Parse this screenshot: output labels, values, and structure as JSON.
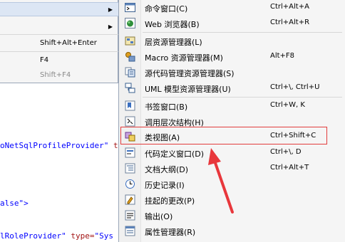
{
  "parent_menu": {
    "items": [
      {
        "label": "",
        "shortcut": "",
        "submenu": true
      },
      {
        "label": "",
        "shortcut": "",
        "submenu": true
      },
      {
        "label": "",
        "shortcut": "Shift+Alt+Enter",
        "submenu": false
      },
      {
        "label": "",
        "shortcut": "F4",
        "submenu": false
      },
      {
        "label": "",
        "shortcut": "Shift+F4",
        "submenu": false,
        "disabled": true
      }
    ]
  },
  "code_lines": [
    {
      "parts": [
        {
          "text": "oNetSqlProfileProvider\"",
          "cls": "c-blue"
        },
        {
          "text": " t",
          "cls": "c-red"
        }
      ]
    },
    {
      "parts": [
        {
          "text": "alse\">",
          "cls": "c-blue"
        }
      ]
    },
    {
      "parts": [
        {
          "text": "lRoleProvider\"",
          "cls": "c-blue"
        },
        {
          "text": " type=",
          "cls": "c-red"
        },
        {
          "text": "\"Sys",
          "cls": "c-blue"
        }
      ]
    }
  ],
  "submenu": {
    "items": [
      {
        "label": "命令窗口(C)",
        "shortcut": "Ctrl+Alt+A",
        "icon": "command-window-icon"
      },
      {
        "label": "Web 浏览器(B)",
        "shortcut": "Ctrl+Alt+R",
        "icon": "web-browser-icon"
      },
      {
        "label": "层资源管理器(L)",
        "shortcut": "",
        "icon": "layer-explorer-icon"
      },
      {
        "label": "Macro 资源管理器(M)",
        "shortcut": "Alt+F8",
        "icon": "macro-explorer-icon"
      },
      {
        "label": "源代码管理资源管理器(S)",
        "shortcut": "",
        "icon": "source-control-icon"
      },
      {
        "label": "UML 模型资源管理器(U)",
        "shortcut": "Ctrl+\\, Ctrl+U",
        "icon": "uml-explorer-icon"
      },
      {
        "label": "书签窗口(B)",
        "shortcut": "Ctrl+W, K",
        "icon": "bookmark-icon"
      },
      {
        "label": "调用层次结构(H)",
        "shortcut": "",
        "icon": "call-hierarchy-icon"
      },
      {
        "label": "类视图(A)",
        "shortcut": "Ctrl+Shift+C",
        "icon": "class-view-icon"
      },
      {
        "label": "代码定义窗口(D)",
        "shortcut": "Ctrl+\\, D",
        "icon": "code-definition-icon"
      },
      {
        "label": "文档大纲(D)",
        "shortcut": "Ctrl+Alt+T",
        "icon": "document-outline-icon"
      },
      {
        "label": "历史记录(I)",
        "shortcut": "",
        "icon": "history-icon"
      },
      {
        "label": "挂起的更改(P)",
        "shortcut": "",
        "icon": "pending-changes-icon"
      },
      {
        "label": "输出(O)",
        "shortcut": "",
        "icon": "output-icon"
      },
      {
        "label": "属性管理器(R)",
        "shortcut": "",
        "icon": "property-manager-icon"
      }
    ]
  },
  "colors": {
    "highlight_box": "#e23c3c",
    "arrow": "#e8373c"
  }
}
